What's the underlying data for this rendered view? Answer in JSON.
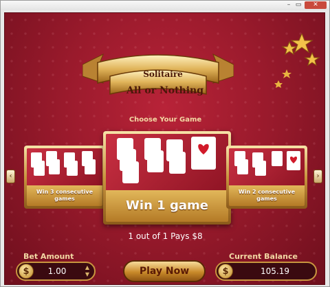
{
  "window": {
    "min_glyph": "–",
    "max_glyph": "▭",
    "close_glyph": "✕"
  },
  "logo": {
    "top": "Solitaire",
    "main": "All or Nothing"
  },
  "choose_title": "Choose Your Game",
  "nav": {
    "left": "‹",
    "right": "›"
  },
  "games": [
    {
      "label": "Win 3 consecutive games"
    },
    {
      "label": "Win 1 game"
    },
    {
      "label": "Win 2 consecutive games"
    }
  ],
  "pays_text": "1 out of 1 Pays $8",
  "bet": {
    "label": "Bet Amount",
    "currency": "$",
    "value": "1.00",
    "up": "▲",
    "down": "▼"
  },
  "balance": {
    "label": "Current Balance",
    "currency": "$",
    "value": "105.19"
  },
  "play_label": "Play Now",
  "colors": {
    "felt": "#9a1a2c",
    "gold": "#c9963f",
    "text_gold": "#f3d9a4"
  }
}
